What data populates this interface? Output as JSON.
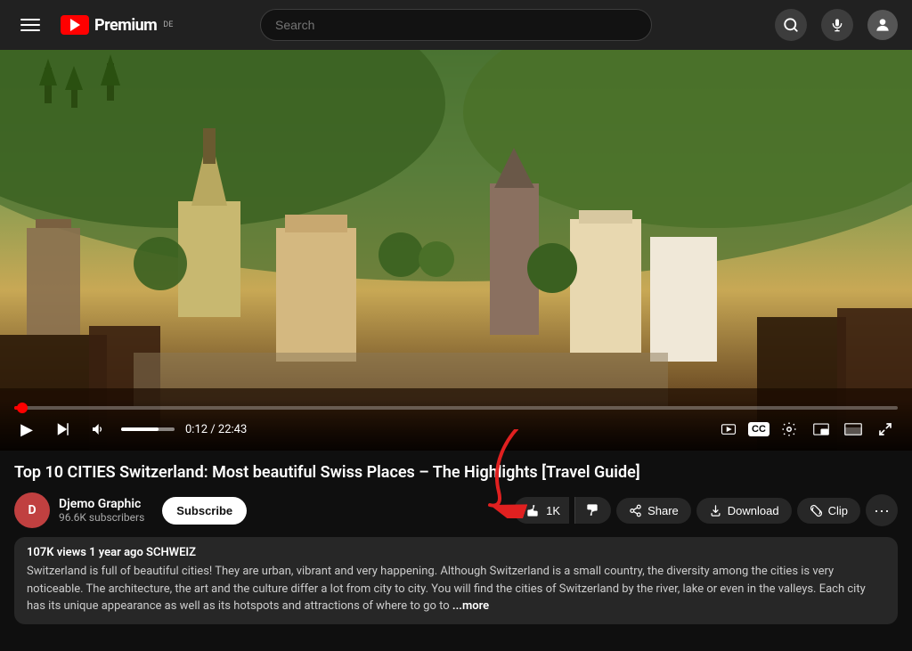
{
  "header": {
    "menu_label": "Menu",
    "logo_text": "Premium",
    "logo_badge": "DE",
    "search_placeholder": "Search"
  },
  "video": {
    "title": "Top 10 CITIES Switzerland: Most beautiful Swiss Places – The Highlights [Travel Guide]",
    "time_current": "0:12",
    "time_total": "22:43",
    "progress_percent": 0.9,
    "volume_percent": 70
  },
  "channel": {
    "name": "Djemo Graphic",
    "subscribers": "96.6K subscribers",
    "avatar_text": "D"
  },
  "actions": {
    "like_label": "1K",
    "dislike_label": "",
    "share_label": "Share",
    "download_label": "Download",
    "clip_label": "Clip"
  },
  "subscribe": {
    "label": "Subscribe"
  },
  "description": {
    "meta": "107K views  1 year ago  SCHWEIZ",
    "text": "Switzerland is full of beautiful cities! They are urban, vibrant and very happening. Although Switzerland is a small country, the diversity among the cities is very noticeable. The architecture, the art and the culture differ a lot from city to city. You will find the cities of Switzerland by the river, lake or even in the valleys. Each city has its unique appearance as well as its hotspots and attractions of where to go to",
    "more_label": "...more"
  },
  "controls": {
    "play_icon": "▶",
    "next_icon": "⏭",
    "volume_icon": "🔊",
    "live_icon": "🔴",
    "subtitles_icon": "CC",
    "settings_icon": "⚙",
    "miniplayer_icon": "⧉",
    "theater_icon": "▬",
    "fullscreen_icon": "⛶"
  }
}
